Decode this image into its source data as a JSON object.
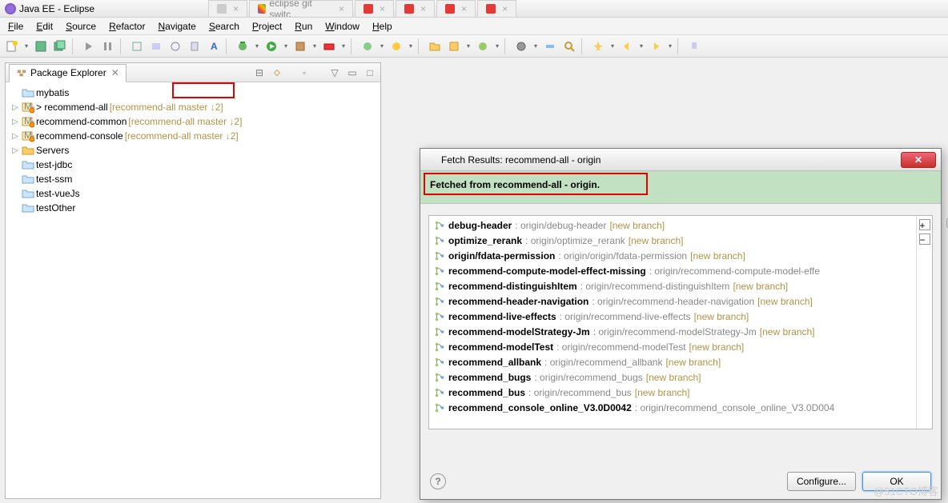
{
  "window": {
    "title": "Java EE - Eclipse"
  },
  "browserTabs": [
    {
      "label": "",
      "cls": ""
    },
    {
      "label": "eclipse git switc…",
      "cls": "g"
    },
    {
      "label": "",
      "cls": "r"
    },
    {
      "label": "",
      "cls": "r"
    },
    {
      "label": "",
      "cls": "r"
    },
    {
      "label": "",
      "cls": "r"
    }
  ],
  "menu": [
    "File",
    "Edit",
    "Source",
    "Refactor",
    "Navigate",
    "Search",
    "Project",
    "Run",
    "Window",
    "Help"
  ],
  "explorer": {
    "title": "Package Explorer",
    "items": [
      {
        "arrow": "",
        "icon": "project",
        "label": "mybatis",
        "decor": ""
      },
      {
        "arrow": "▷",
        "icon": "git",
        "label": "> recommend-all",
        "decor": "  [recommend-all master ↓2]"
      },
      {
        "arrow": "▷",
        "icon": "git",
        "label": "recommend-common",
        "decor": "  [recommend-all master ↓2]"
      },
      {
        "arrow": "▷",
        "icon": "git",
        "label": "recommend-console",
        "decor": "  [recommend-all master ↓2]"
      },
      {
        "arrow": "▷",
        "icon": "folder",
        "label": "Servers",
        "decor": ""
      },
      {
        "arrow": "",
        "icon": "project",
        "label": "test-jdbc",
        "decor": ""
      },
      {
        "arrow": "",
        "icon": "project",
        "label": "test-ssm",
        "decor": ""
      },
      {
        "arrow": "",
        "icon": "project",
        "label": "test-vueJs",
        "decor": ""
      },
      {
        "arrow": "",
        "icon": "project",
        "label": "testOther",
        "decor": ""
      }
    ]
  },
  "dialog": {
    "title": "Fetch Results: recommend-all - origin",
    "header": "Fetched from recommend-all - origin.",
    "results": [
      {
        "name": "debug-header",
        "path": ": origin/debug-header",
        "tag": "[new branch]"
      },
      {
        "name": "optimize_rerank",
        "path": ": origin/optimize_rerank",
        "tag": "[new branch]"
      },
      {
        "name": "origin/fdata-permission",
        "path": ": origin/origin/fdata-permission",
        "tag": "[new branch]"
      },
      {
        "name": "recommend-compute-model-effect-missing",
        "path": ": origin/recommend-compute-model-effe",
        "tag": ""
      },
      {
        "name": "recommend-distinguishItem",
        "path": ": origin/recommend-distinguishItem",
        "tag": "[new branch]"
      },
      {
        "name": "recommend-header-navigation",
        "path": ": origin/recommend-header-navigation",
        "tag": "[new branch]"
      },
      {
        "name": "recommend-live-effects",
        "path": ": origin/recommend-live-effects",
        "tag": "[new branch]"
      },
      {
        "name": "recommend-modelStrategy-Jm",
        "path": ": origin/recommend-modelStrategy-Jm",
        "tag": "[new branch]"
      },
      {
        "name": "recommend-modelTest",
        "path": ": origin/recommend-modelTest",
        "tag": "[new branch]"
      },
      {
        "name": "recommend_allbank",
        "path": ": origin/recommend_allbank",
        "tag": "[new branch]"
      },
      {
        "name": "recommend_bugs",
        "path": ": origin/recommend_bugs",
        "tag": "[new branch]"
      },
      {
        "name": "recommend_bus",
        "path": ": origin/recommend_bus",
        "tag": "[new branch]"
      },
      {
        "name": "recommend_console_online_V3.0D0042",
        "path": ": origin/recommend_console_online_V3.0D004",
        "tag": ""
      }
    ],
    "configure": "Configure...",
    "ok": "OK"
  },
  "watermark": "@51CTO博客"
}
